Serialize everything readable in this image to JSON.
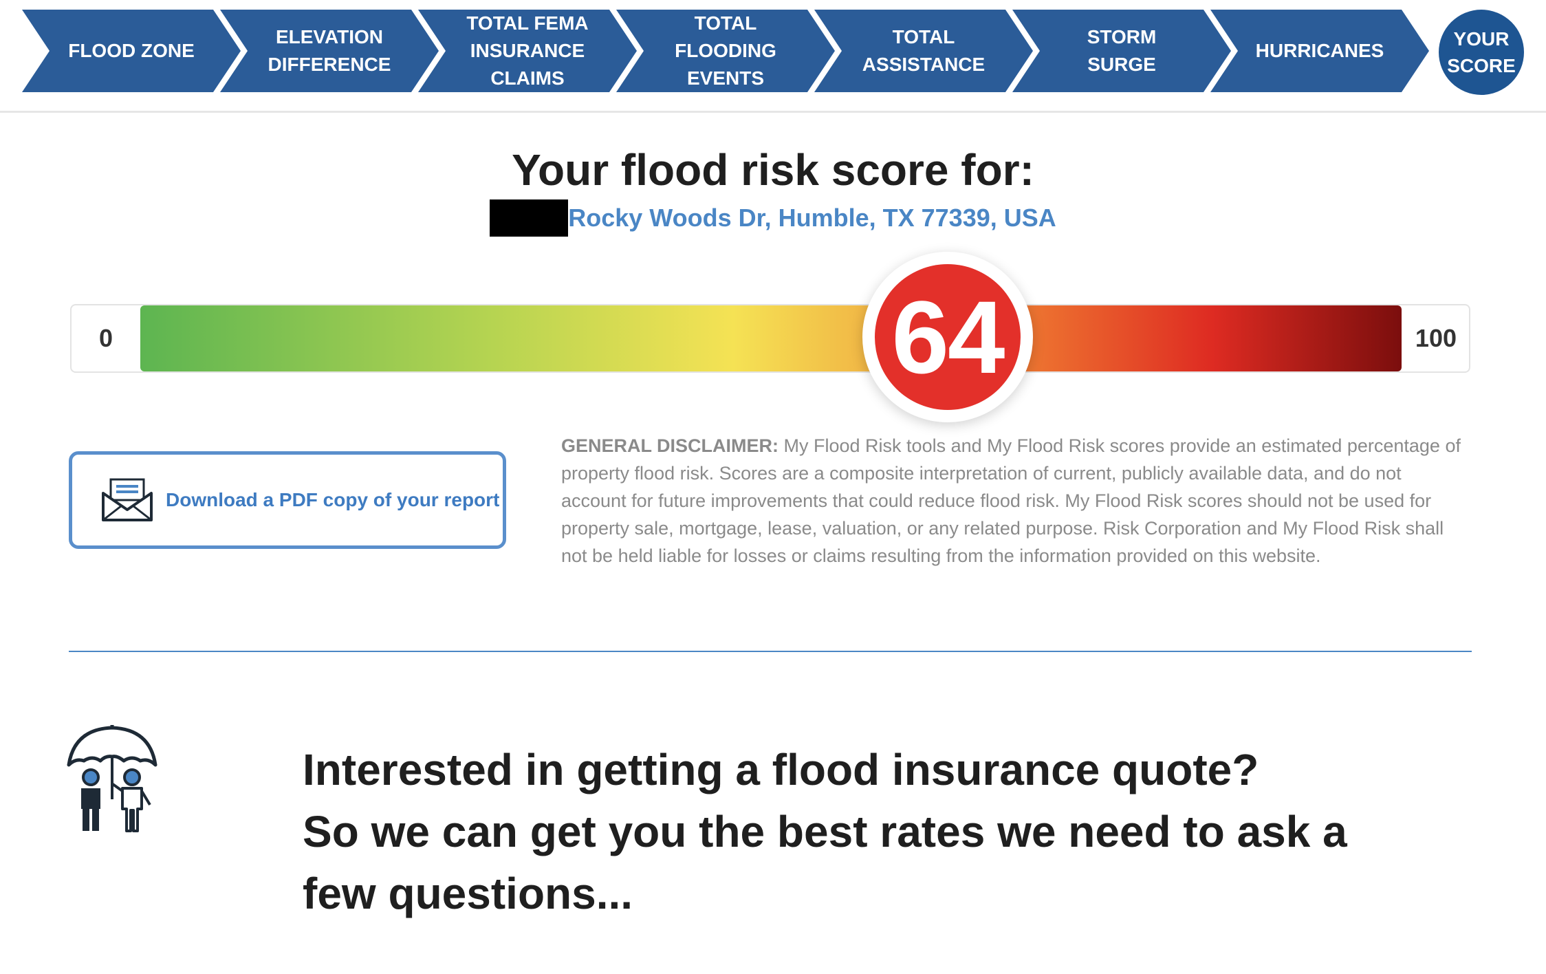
{
  "nav": {
    "steps": [
      {
        "label": "FLOOD ZONE"
      },
      {
        "label": "ELEVATION\nDIFFERENCE"
      },
      {
        "label": "TOTAL FEMA\nINSURANCE\nCLAIMS"
      },
      {
        "label": "TOTAL\nFLOODING\nEVENTS"
      },
      {
        "label": "TOTAL\nASSISTANCE"
      },
      {
        "label": "STORM\nSURGE"
      },
      {
        "label": "HURRICANES"
      }
    ],
    "final_step": "YOUR\nSCORE",
    "color": "#2b5c98"
  },
  "score": {
    "title": "Your flood risk score for:",
    "address": "Rocky Woods Dr, Humble, TX 77339, USA",
    "value": "64",
    "value_fraction": 0.64,
    "min_label": "0",
    "max_label": "100",
    "badge_color": "#e3302a"
  },
  "download": {
    "label": "Download a PDF copy of your report",
    "icon": "envelope-icon"
  },
  "disclaimer": {
    "heading": "GENERAL DISCLAIMER:",
    "text": " My Flood Risk tools and My Flood Risk scores provide an estimated percentage of property flood risk. Scores are a composite interpretation of current, publicly available data, and do not account for future improvements that could reduce flood risk. My Flood Risk scores should not be used for property sale, mortgage, lease, valuation, or any related purpose. Risk Corporation and My Flood Risk shall not be held liable for losses or claims resulting from the information provided on this website."
  },
  "quote": {
    "line1": "Interested in getting a flood insurance quote?",
    "line2": "So we can get you the best rates we need to ask a few questions...",
    "icon": "umbrella-family-icon"
  }
}
